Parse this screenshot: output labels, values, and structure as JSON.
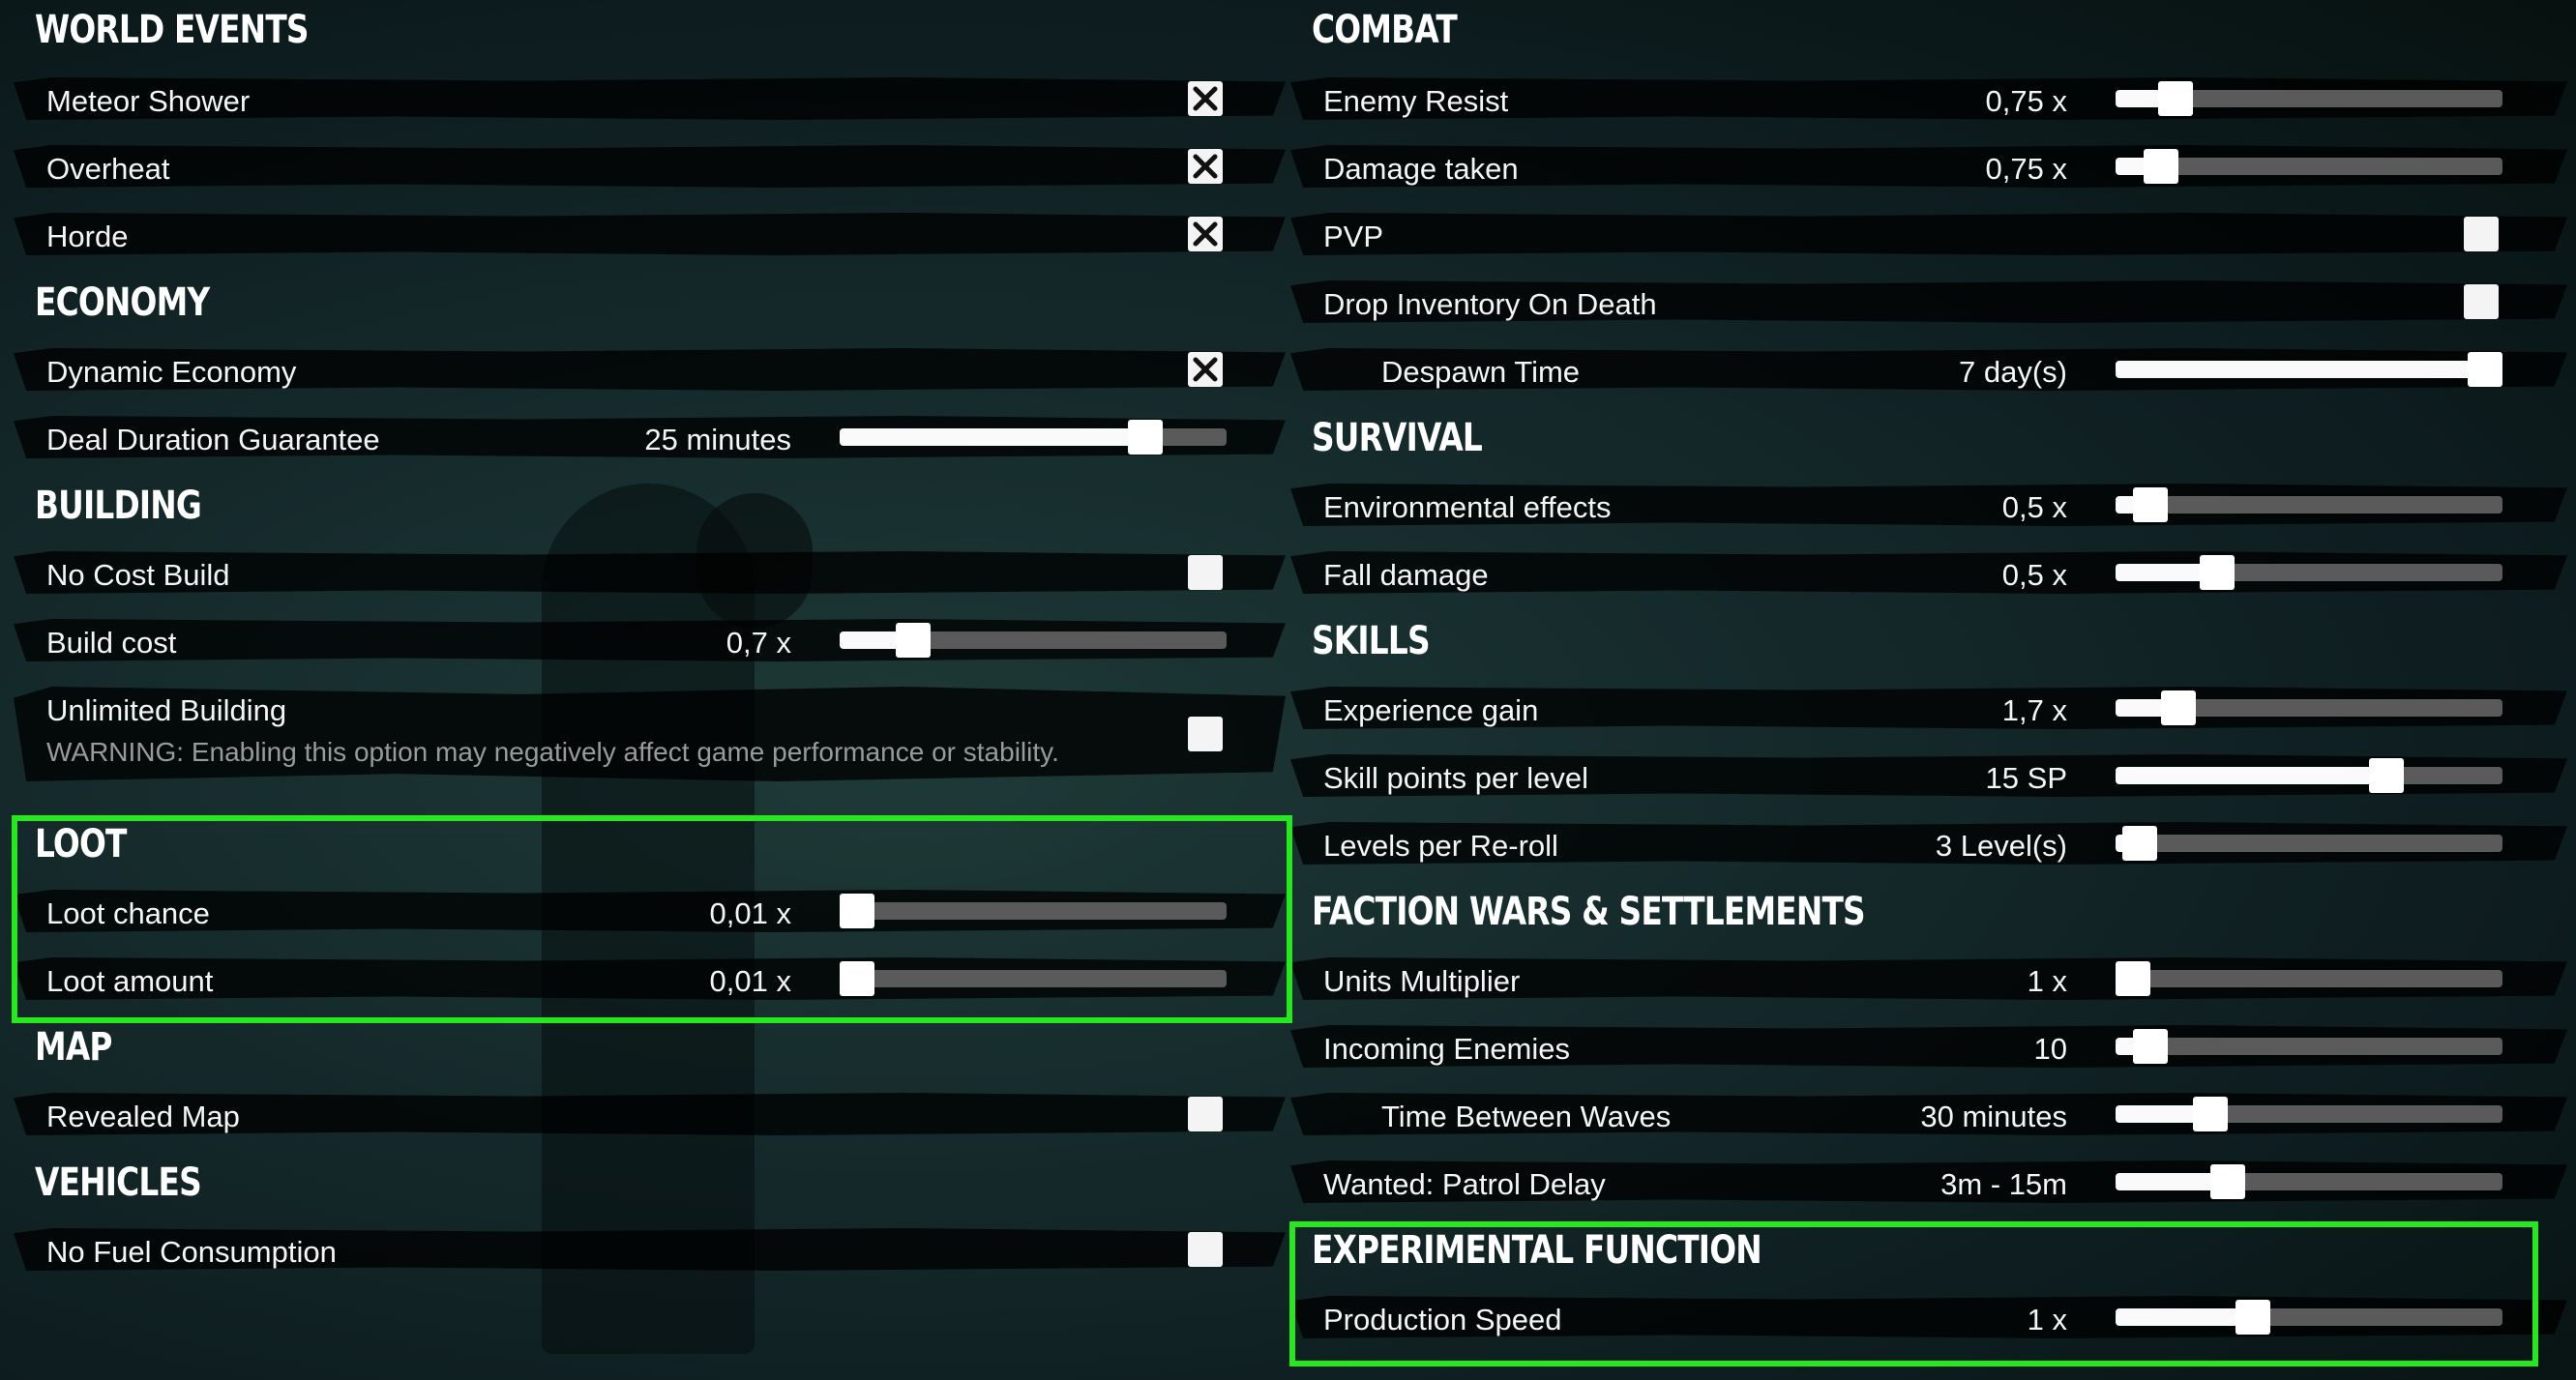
{
  "left": {
    "world_events": {
      "title": "WORLD EVENTS",
      "items": [
        {
          "label": "Meteor Shower",
          "checked": true
        },
        {
          "label": "Overheat",
          "checked": true
        },
        {
          "label": "Horde",
          "checked": true
        }
      ]
    },
    "economy": {
      "title": "ECONOMY",
      "items": [
        {
          "label": "Dynamic Economy",
          "checked": true
        },
        {
          "label": "Deal Duration Guarantee",
          "value": "25 minutes",
          "level": 0.82
        }
      ]
    },
    "building": {
      "title": "BUILDING",
      "items": [
        {
          "label": "No Cost Build",
          "checked": false
        },
        {
          "label": "Build cost",
          "value": "0,7 x",
          "level": 0.16
        },
        {
          "label": "Unlimited Building",
          "checked": false,
          "warning": "WARNING: Enabling this option may negatively affect game performance or stability."
        }
      ]
    },
    "loot": {
      "title": "LOOT",
      "items": [
        {
          "label": "Loot chance",
          "value": "0,01 x",
          "level": 0.0
        },
        {
          "label": "Loot amount",
          "value": "0,01 x",
          "level": 0.0
        }
      ]
    },
    "map": {
      "title": "MAP",
      "items": [
        {
          "label": "Revealed Map",
          "checked": false
        }
      ]
    },
    "vehicles": {
      "title": "VEHICLES",
      "items": [
        {
          "label": "No Fuel Consumption",
          "checked": false
        }
      ]
    }
  },
  "right": {
    "combat": {
      "title": "COMBAT",
      "items": [
        {
          "label": "Enemy Resist",
          "value": "0,75 x",
          "level": 0.12
        },
        {
          "label": "Damage taken",
          "value": "0,75 x",
          "level": 0.08
        },
        {
          "label": "PVP",
          "checked": false
        },
        {
          "label": "Drop Inventory On Death",
          "checked": false
        },
        {
          "label": "Despawn Time",
          "value": "7 day(s)",
          "level": 1.0
        }
      ]
    },
    "survival": {
      "title": "SURVIVAL",
      "items": [
        {
          "label": "Environmental effects",
          "value": "0,5 x",
          "level": 0.05
        },
        {
          "label": "Fall damage",
          "value": "0,5 x",
          "level": 0.24
        }
      ]
    },
    "skills": {
      "title": "SKILLS",
      "items": [
        {
          "label": "Experience gain",
          "value": "1,7 x",
          "level": 0.13
        },
        {
          "label": "Skill points per level",
          "value": "15 SP",
          "level": 0.72
        },
        {
          "label": "Levels per Re-roll",
          "value": "3 Level(s)",
          "level": 0.02
        }
      ]
    },
    "faction": {
      "title": "FACTION WARS & SETTLEMENTS",
      "items": [
        {
          "label": "Units Multiplier",
          "value": "1 x",
          "level": 0.0
        },
        {
          "label": "Incoming Enemies",
          "value": "10",
          "level": 0.05
        },
        {
          "label": "Time Between Waves",
          "value": "30 minutes",
          "level": 0.22
        },
        {
          "label": "Wanted: Patrol Delay",
          "value": "3m - 15m",
          "level": 0.27
        }
      ]
    },
    "experimental": {
      "title": "EXPERIMENTAL FUNCTION",
      "items": [
        {
          "label": "Production Speed",
          "value": "1 x",
          "level": 0.34
        }
      ]
    }
  }
}
